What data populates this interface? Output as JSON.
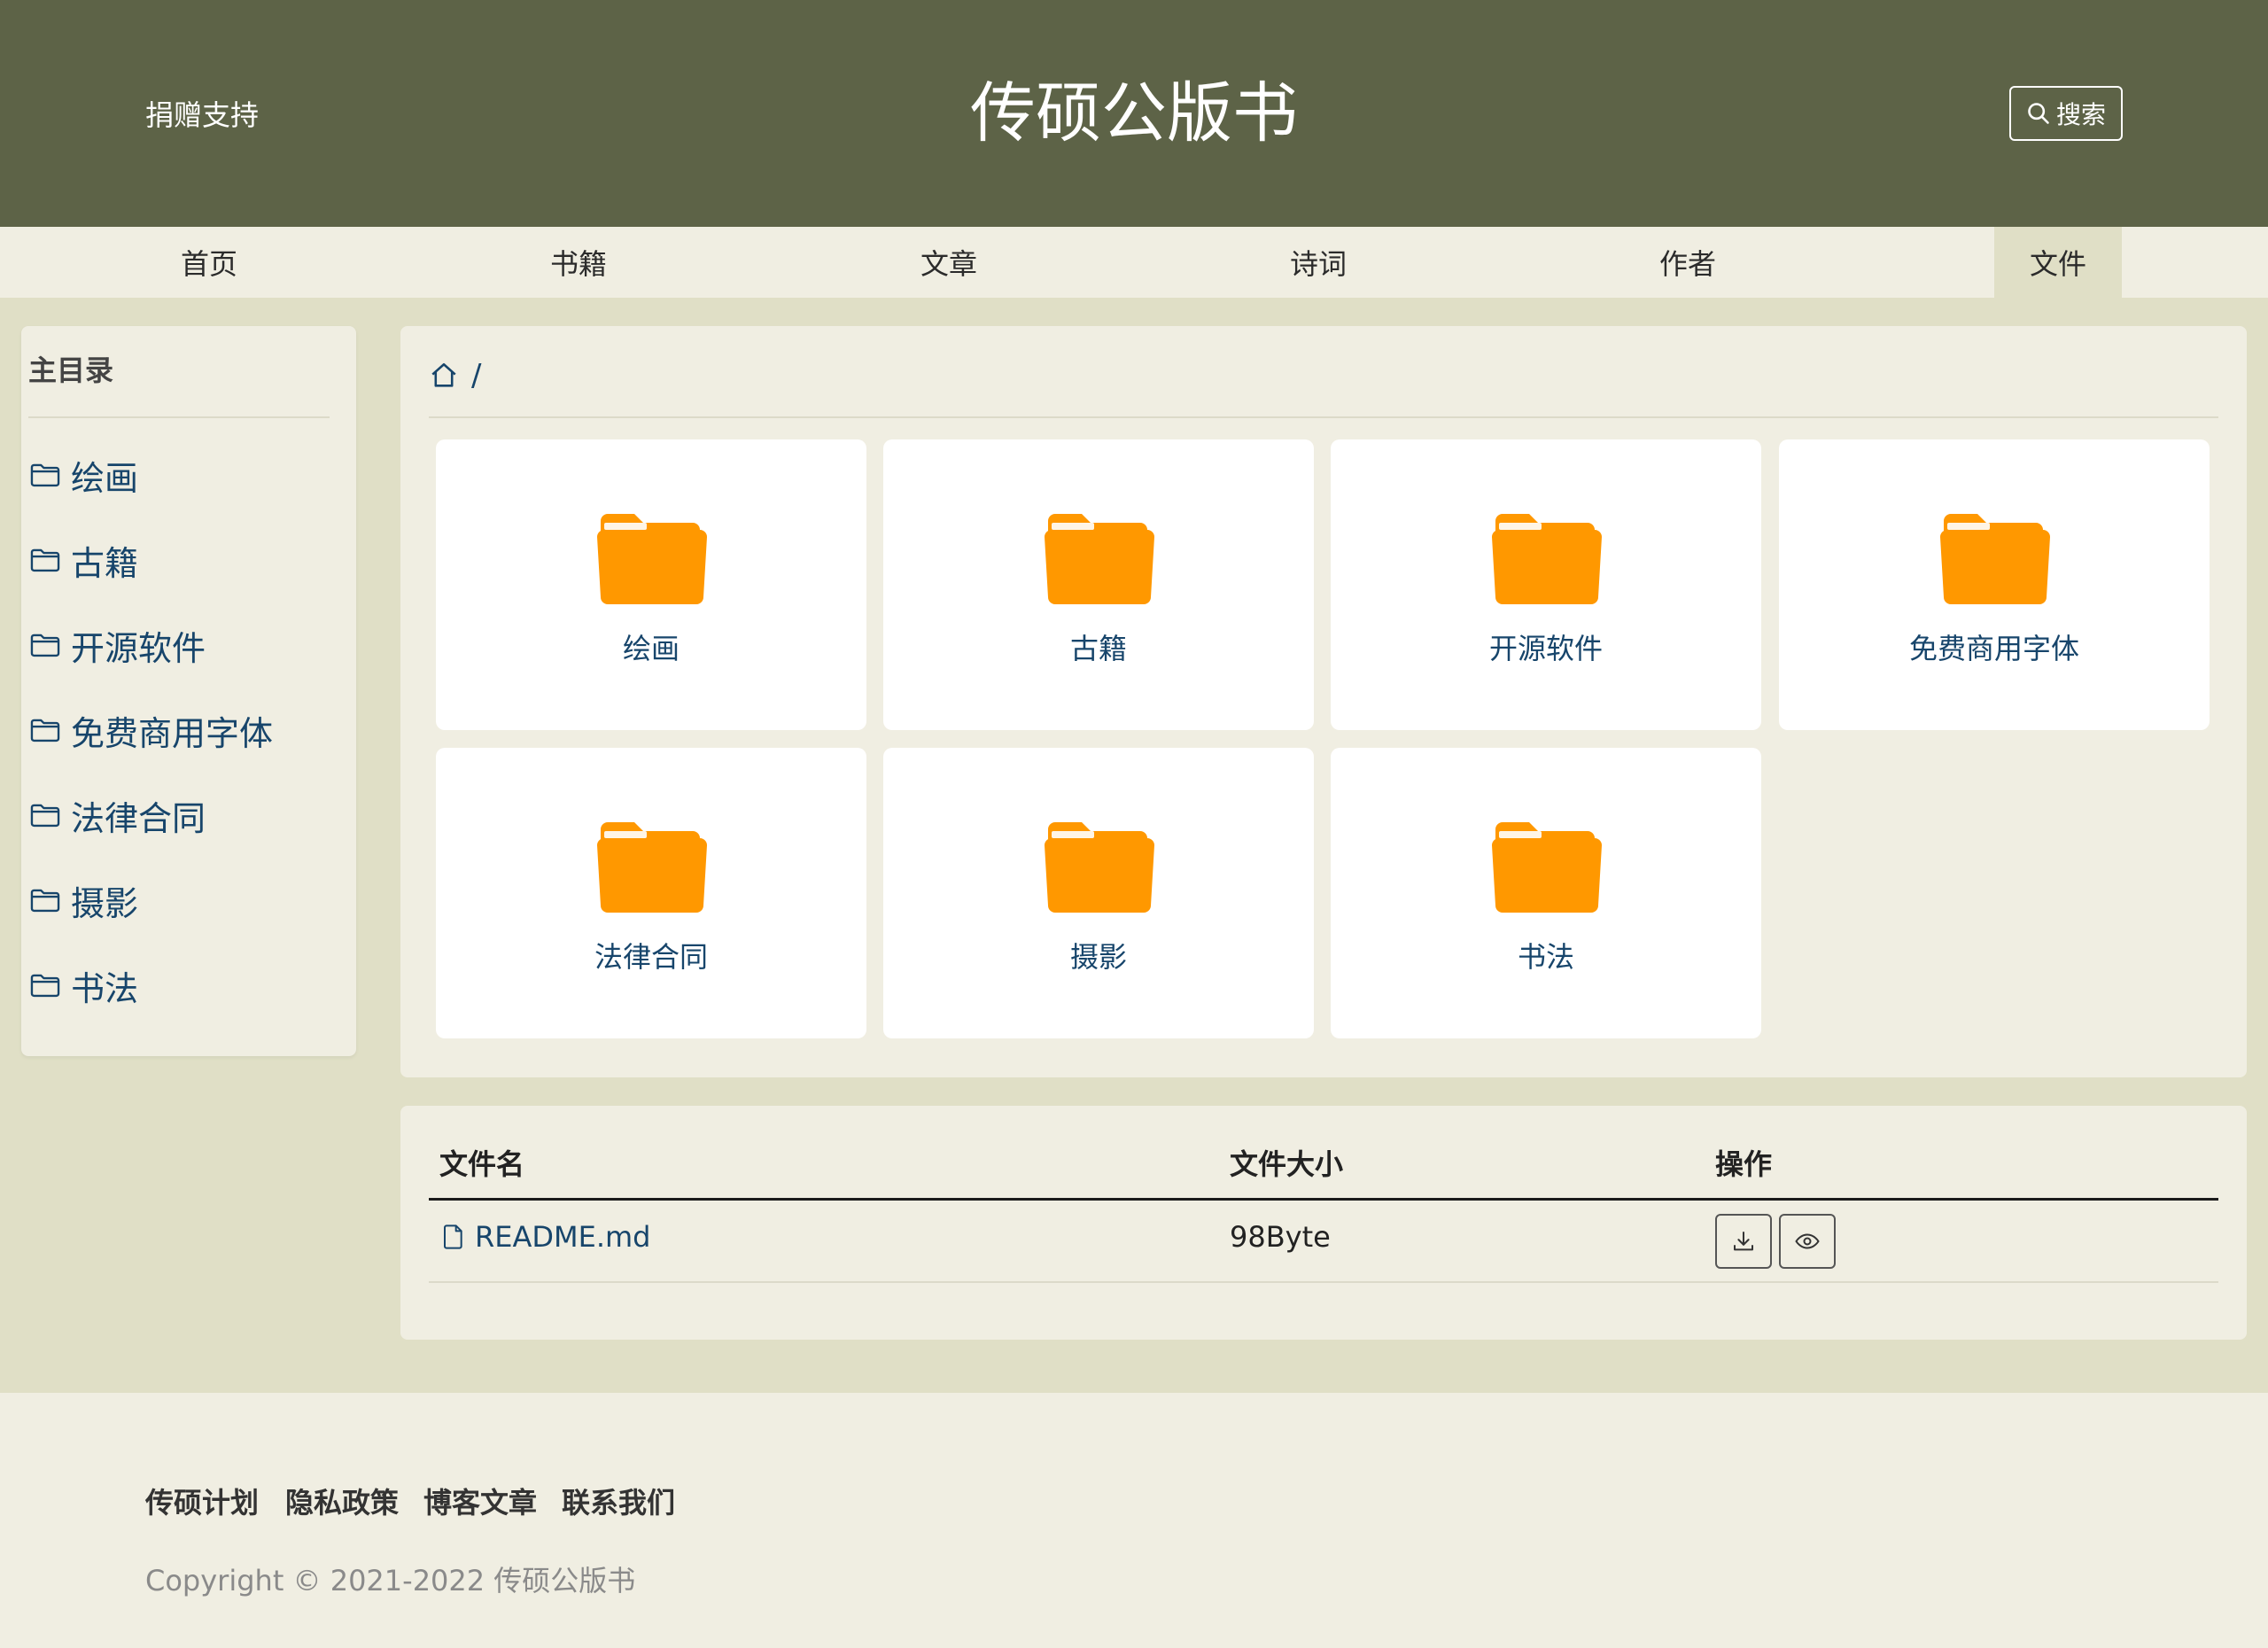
{
  "header": {
    "donate": "捐赠支持",
    "title": "传硕公版书",
    "search_label": "搜索"
  },
  "nav": {
    "items": [
      "首页",
      "书籍",
      "文章",
      "诗词",
      "作者",
      "文件"
    ],
    "active": "文件"
  },
  "sidebar": {
    "title": "主目录",
    "items": [
      "绘画",
      "古籍",
      "开源软件",
      "免费商用字体",
      "法律合同",
      "摄影",
      "书法"
    ]
  },
  "breadcrumb": {
    "separator": "/"
  },
  "folders": [
    "绘画",
    "古籍",
    "开源软件",
    "免费商用字体",
    "法律合同",
    "摄影",
    "书法"
  ],
  "files": {
    "headers": {
      "name": "文件名",
      "size": "文件大小",
      "actions": "操作"
    },
    "rows": [
      {
        "name": "README.md",
        "size": "98Byte"
      }
    ]
  },
  "footer": {
    "links": [
      "传硕计划",
      "隐私政策",
      "博客文章",
      "联系我们"
    ],
    "copyright": "Copyright © 2021-2022 传硕公版书"
  },
  "colors": {
    "header_bg": "#5d6347",
    "page_bg": "#e0dfc6",
    "panel_bg": "#f0eee2",
    "link": "#17456b",
    "folder": "#ff9800"
  },
  "icons": {
    "search": "search-icon",
    "folder_outline": "folder-outline-icon",
    "folder_filled": "folder-icon",
    "home": "home-icon",
    "file": "file-icon",
    "download": "download-icon",
    "preview": "eye-icon"
  }
}
